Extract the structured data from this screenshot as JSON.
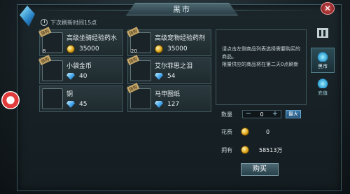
{
  "window": {
    "title": "黑市"
  },
  "refresh_note": "下次刷新时间15点",
  "items": [
    {
      "name": "高级坐骑经验药水",
      "qty": "8",
      "tag": "限购",
      "price": "35000",
      "currency": "coin",
      "icon": "green-potion-icon"
    },
    {
      "name": "高级宠物经验药剂",
      "qty": "20",
      "tag": "限购",
      "price": "35000",
      "currency": "coin",
      "icon": "pink-potion-icon"
    },
    {
      "name": "小袋金币",
      "qty": "",
      "tag": "限购",
      "price": "40",
      "currency": "diamond",
      "icon": "coin-bag-icon"
    },
    {
      "name": "艾尔菲思之泪",
      "qty": "",
      "tag": "限购",
      "price": "54",
      "currency": "diamond",
      "icon": "tear-drop-icon"
    },
    {
      "name": "铜",
      "qty": "",
      "tag": "",
      "price": "45",
      "currency": "diamond",
      "icon": "copper-ingot-icon"
    },
    {
      "name": "马甲图纸",
      "qty": "",
      "tag": "限购",
      "price": "127",
      "currency": "diamond",
      "icon": "scroll-icon"
    }
  ],
  "description": {
    "line1": "请点击左侧商品列表选择需要购买的商品。",
    "line2": "限量供应的商品将在第二天0点刷新"
  },
  "purchase": {
    "qty_label": "数量",
    "qty_value": "0",
    "minus": "−",
    "plus": "+",
    "max_label": "最大",
    "cost_label": "花费",
    "cost_value": "0",
    "own_label": "拥有",
    "own_value": "58513万",
    "buy_label": "购买"
  },
  "side_tabs": [
    {
      "label": "",
      "icon": "pillar-icon"
    },
    {
      "label": "黑市",
      "icon": "black-market-icon"
    },
    {
      "label": "充值",
      "icon": "recharge-icon"
    }
  ],
  "colors": {
    "accent": "#4fd4ff",
    "close": "#c92c2c",
    "coin": "#e0a81c",
    "diamond": "#3ea0e8"
  }
}
